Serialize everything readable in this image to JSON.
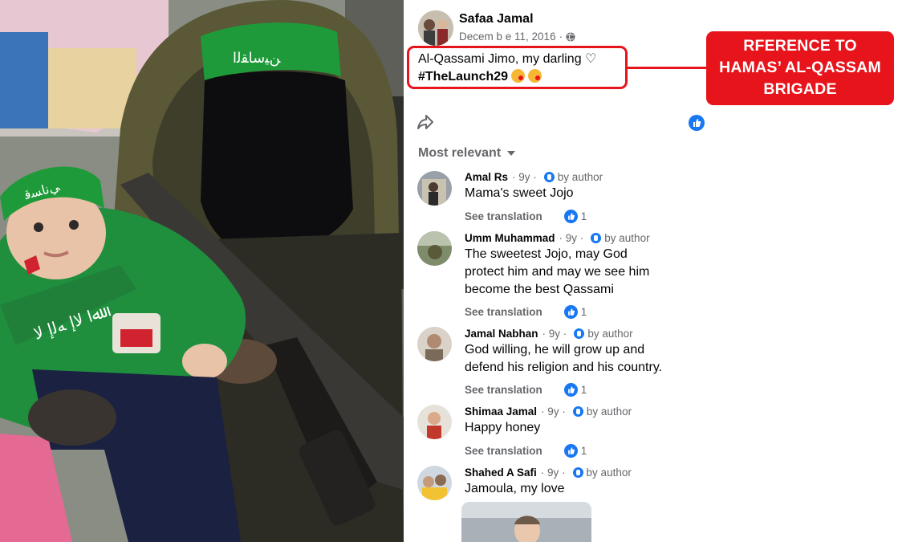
{
  "post": {
    "author": "Safaa Jamal",
    "date": "Decem b e 11, 2016",
    "separator": "·",
    "text_line1": "Al-Qassami Jimo, my darling ♡",
    "hashtag": "#TheLaunch29"
  },
  "annotation": {
    "line1": "RFERENCE TO",
    "line2": "HAMAS’ AL-QASSAM",
    "line3": "BRIGADE",
    "color": "#e8141c"
  },
  "sort": {
    "label": "Most relevant"
  },
  "comments": [
    {
      "name": "Amal Rs",
      "time": "· 9y ·",
      "badge": "by author",
      "lines": [
        "Mama's sweet Jojo"
      ],
      "action": "See translation",
      "reactions": "1"
    },
    {
      "name": "Umm Muhammad",
      "time": "· 9y ·",
      "badge": "by author",
      "lines": [
        "The sweetest Jojo, may God",
        "protect him and may we see him",
        "become the best Qassami"
      ],
      "action": "See translation",
      "reactions": "1"
    },
    {
      "name": "Jamal Nabhan",
      "time": "· 9y ·",
      "badge": "by author",
      "lines": [
        "God willing, he will grow up and",
        "defend his religion and his country."
      ],
      "action": "See translation",
      "reactions": "1"
    },
    {
      "name": "Shimaa Jamal",
      "time": "· 9y ·",
      "badge": "by author",
      "lines": [
        "Happy honey"
      ],
      "action": "See translation",
      "reactions": "1"
    },
    {
      "name": "Shahed A Safi",
      "time": "· 9y ·",
      "badge": "by author",
      "lines": [
        "Jamoula, my love"
      ],
      "action": "",
      "reactions": ""
    }
  ],
  "colors": {
    "facebook_blue": "#1877f2",
    "secondary_text": "#65676b",
    "primary_text": "#050505"
  },
  "icons": {
    "share": "share-icon",
    "like": "like-icon",
    "globe": "globe-icon",
    "caret": "caret-down-icon"
  }
}
